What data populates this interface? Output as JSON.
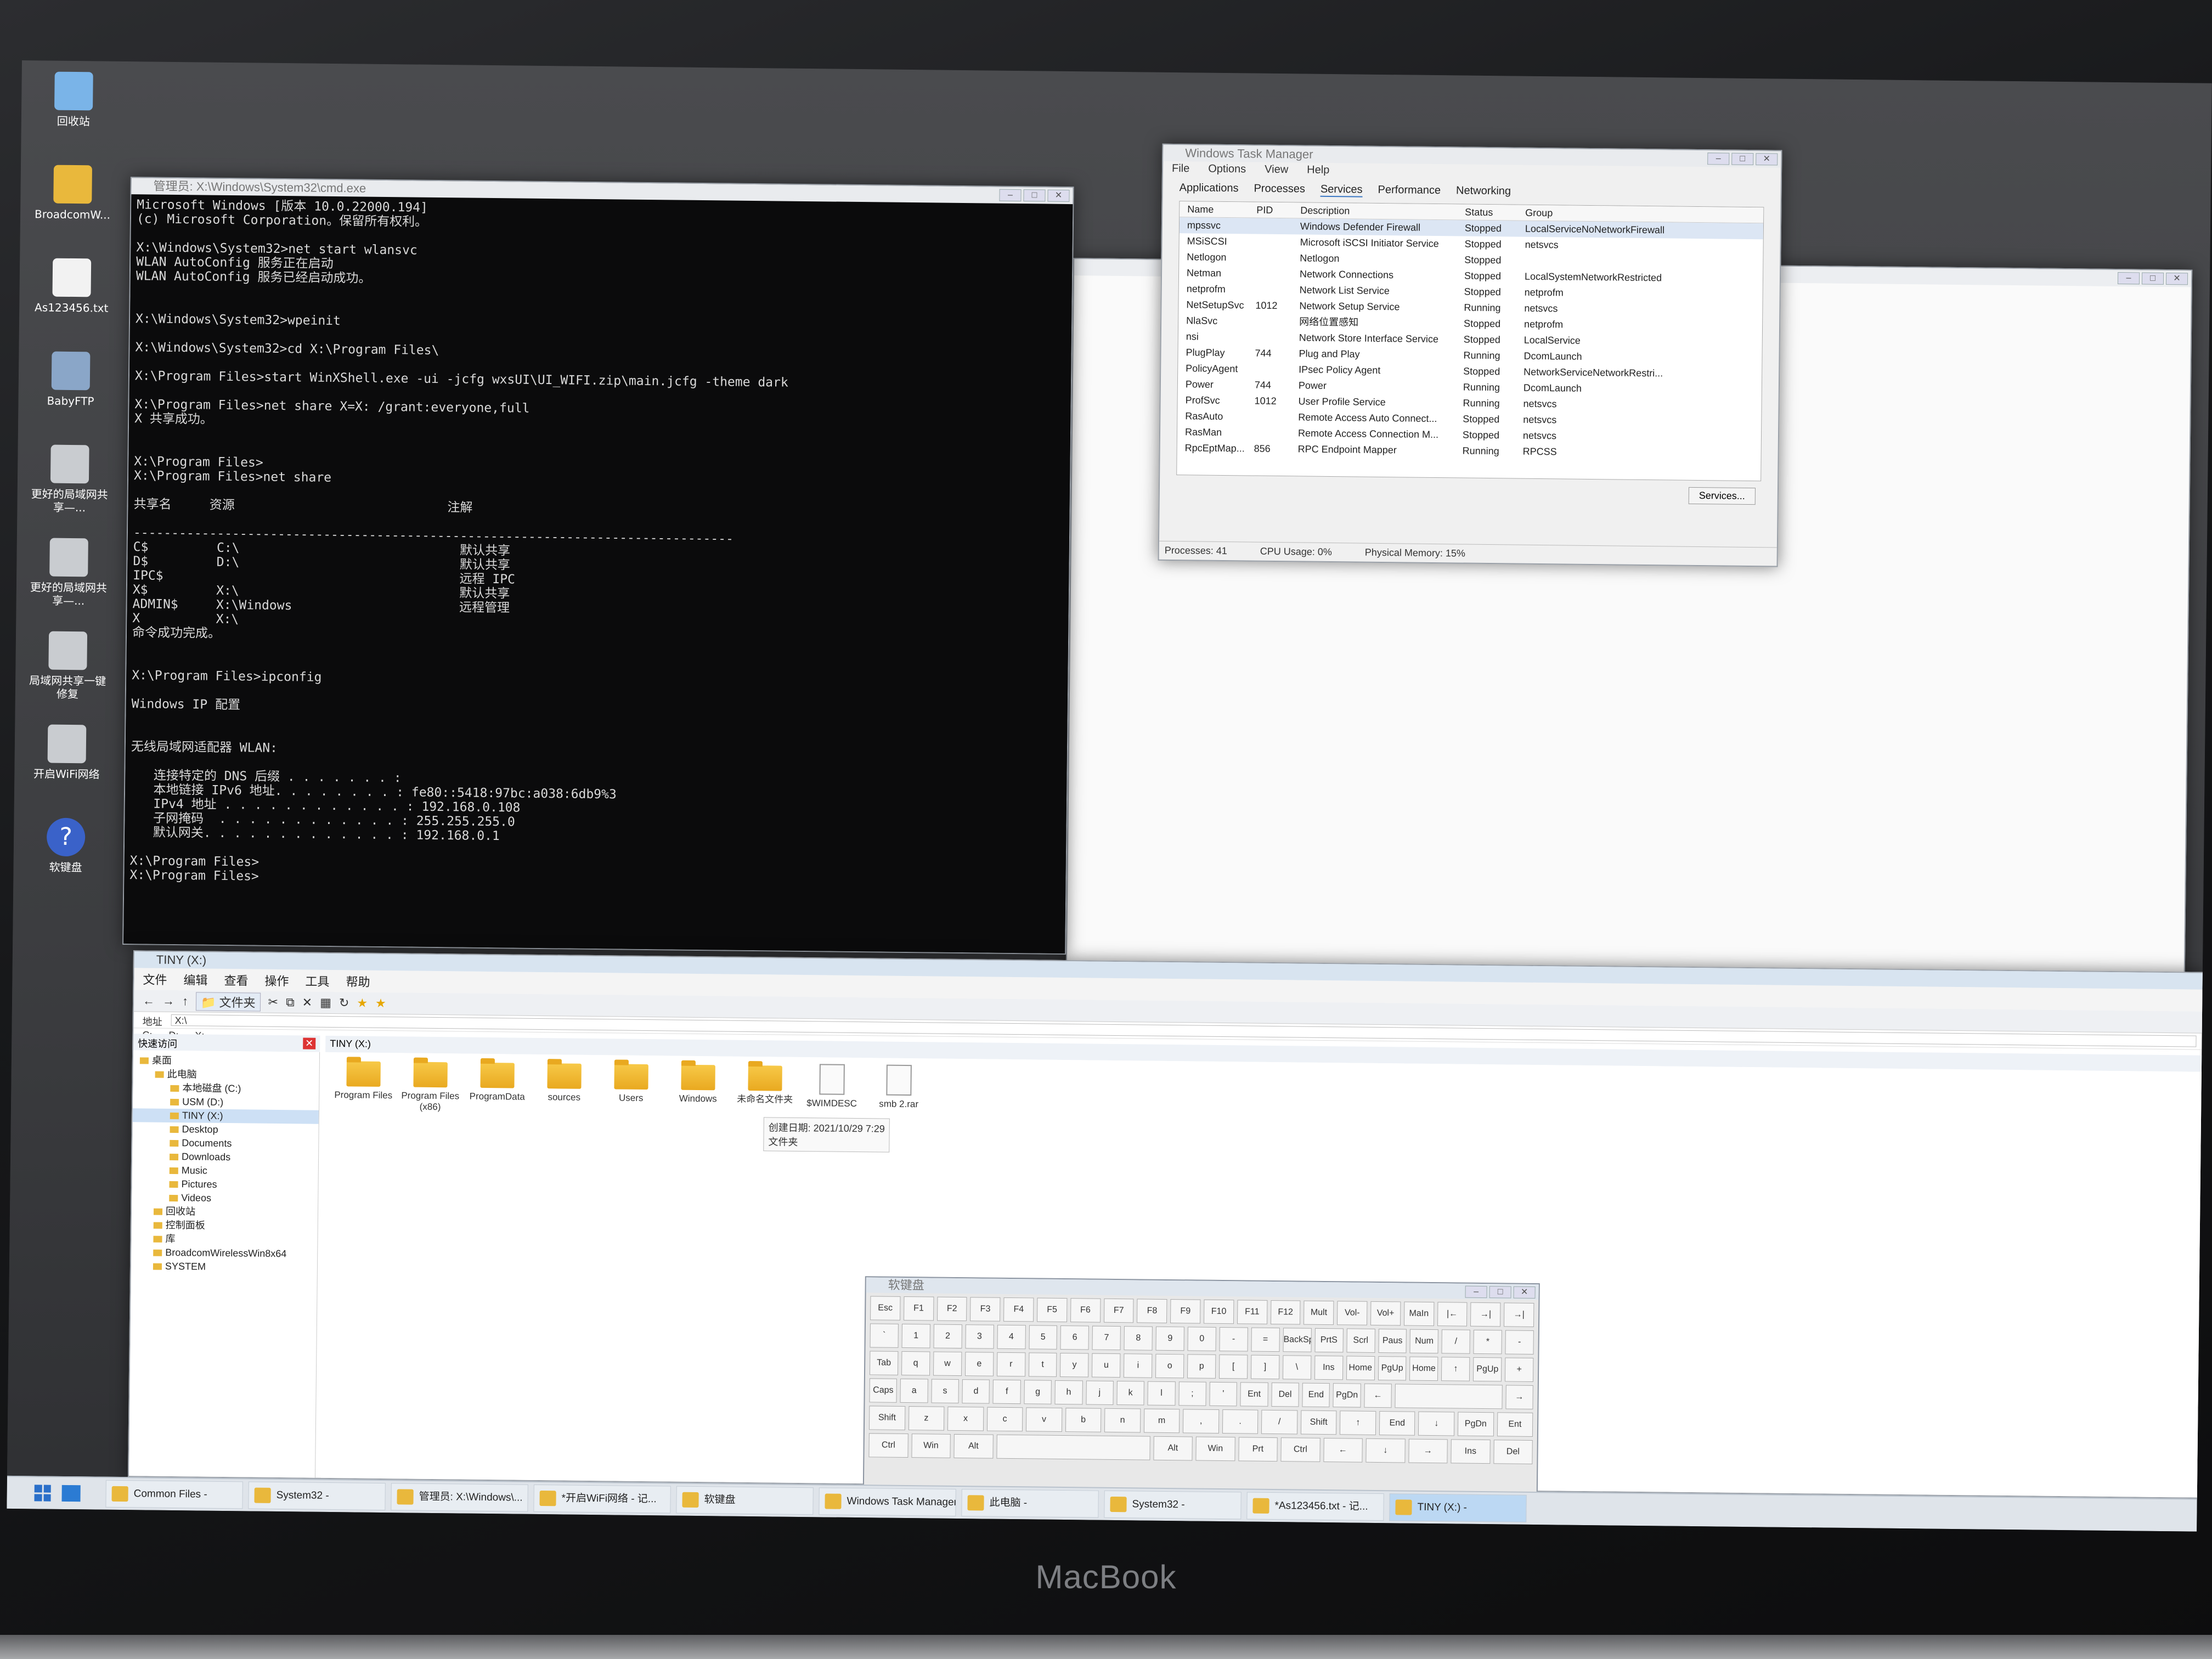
{
  "desktop": {
    "icons": [
      {
        "label": "回收站",
        "icon": "recycle-bin-icon"
      },
      {
        "label": "BroadcomW...",
        "icon": "folder-icon"
      },
      {
        "label": "As123456.txt",
        "icon": "text-file-icon"
      },
      {
        "label": "BabyFTP",
        "icon": "ftp-server-icon"
      },
      {
        "label": "更好的局域网共享—...",
        "icon": "gear-icon"
      },
      {
        "label": "更好的局域网共享—...",
        "icon": "gear-icon"
      },
      {
        "label": "局域网共享一键修复",
        "icon": "gear-icon"
      },
      {
        "label": "开启WiFi网络",
        "icon": "gear-icon"
      },
      {
        "label": "软键盘",
        "icon": "help-icon"
      }
    ]
  },
  "cmd": {
    "title": "管理员: X:\\Windows\\System32\\cmd.exe",
    "lines": [
      "Microsoft Windows [版本 10.0.22000.194]",
      "(c) Microsoft Corporation。保留所有权利。",
      "",
      "X:\\Windows\\System32>net start wlansvc",
      "WLAN AutoConfig 服务正在启动",
      "WLAN AutoConfig 服务已经启动成功。",
      "",
      "",
      "X:\\Windows\\System32>wpeinit",
      "",
      "X:\\Windows\\System32>cd X:\\Program Files\\",
      "",
      "X:\\Program Files>start WinXShell.exe -ui -jcfg wxsUI\\UI_WIFI.zip\\main.jcfg -theme dark",
      "",
      "X:\\Program Files>net share X=X: /grant:everyone,full",
      "X 共享成功。",
      "",
      "",
      "X:\\Program Files>",
      "X:\\Program Files>net share",
      "",
      "共享名     资源                            注解",
      "",
      "-------------------------------------------------------------------------------",
      "C$         C:\\                             默认共享",
      "D$         D:\\                             默认共享",
      "IPC$                                       远程 IPC",
      "X$         X:\\                             默认共享",
      "ADMIN$     X:\\Windows                      远程管理",
      "X          X:\\",
      "命令成功完成。",
      "",
      "",
      "X:\\Program Files>ipconfig",
      "",
      "Windows IP 配置",
      "",
      "",
      "无线局域网适配器 WLAN:",
      "",
      "   连接特定的 DNS 后缀 . . . . . . . :",
      "   本地链接 IPv6 地址. . . . . . . . : fe80::5418:97bc:a038:6db9%3",
      "   IPv4 地址 . . . . . . . . . . . . : 192.168.0.108",
      "   子网掩码  . . . . . . . . . . . . : 255.255.255.0",
      "   默认网关. . . . . . . . . . . . . : 192.168.0.1",
      "",
      "X:\\Program Files>",
      "X:\\Program Files>"
    ]
  },
  "taskmgr": {
    "title": "Windows Task Manager",
    "menu": [
      "File",
      "Options",
      "View",
      "Help"
    ],
    "tabs": [
      "Applications",
      "Processes",
      "Services",
      "Performance",
      "Networking"
    ],
    "columns": [
      "Name",
      "PID",
      "Description",
      "Status",
      "Group"
    ],
    "rows": [
      [
        "mpssvc",
        "",
        "Windows Defender Firewall",
        "Stopped",
        "LocalServiceNoNetworkFirewall"
      ],
      [
        "MSiSCSI",
        "",
        "Microsoft iSCSI Initiator Service",
        "Stopped",
        "netsvcs"
      ],
      [
        "Netlogon",
        "",
        "Netlogon",
        "Stopped",
        ""
      ],
      [
        "Netman",
        "",
        "Network Connections",
        "Stopped",
        "LocalSystemNetworkRestricted"
      ],
      [
        "netprofm",
        "",
        "Network List Service",
        "Stopped",
        "netprofm"
      ],
      [
        "NetSetupSvc",
        "1012",
        "Network Setup Service",
        "Running",
        "netsvcs"
      ],
      [
        "NlaSvc",
        "",
        "网络位置感知",
        "Stopped",
        "netprofm"
      ],
      [
        "nsi",
        "",
        "Network Store Interface Service",
        "Stopped",
        "LocalService"
      ],
      [
        "PlugPlay",
        "744",
        "Plug and Play",
        "Running",
        "DcomLaunch"
      ],
      [
        "PolicyAgent",
        "",
        "IPsec Policy Agent",
        "Stopped",
        "NetworkServiceNetworkRestri..."
      ],
      [
        "Power",
        "744",
        "Power",
        "Running",
        "DcomLaunch"
      ],
      [
        "ProfSvc",
        "1012",
        "User Profile Service",
        "Running",
        "netsvcs"
      ],
      [
        "RasAuto",
        "",
        "Remote Access Auto Connect...",
        "Stopped",
        "netsvcs"
      ],
      [
        "RasMan",
        "",
        "Remote Access Connection M...",
        "Stopped",
        "netsvcs"
      ],
      [
        "RpcEptMap...",
        "856",
        "RPC Endpoint Mapper",
        "Running",
        "RPCSS"
      ]
    ],
    "services_button": "Services...",
    "status": {
      "processes": "Processes: 41",
      "cpu": "CPU Usage: 0%",
      "memory": "Physical Memory: 15%"
    }
  },
  "explorer": {
    "title": "TINY (X:)",
    "menu": [
      "文件",
      "编辑",
      "查看",
      "操作",
      "工具",
      "帮助"
    ],
    "toolbar_folder": "文件夹",
    "address_label": "地址",
    "address_value": "X:\\",
    "drives": [
      "C:",
      "D:",
      "X:"
    ],
    "quick_access": "快速访问",
    "pane_title": "TINY (X:)",
    "tree": [
      {
        "label": "桌面",
        "indent": 0
      },
      {
        "label": "此电脑",
        "indent": 1
      },
      {
        "label": "本地磁盘 (C:)",
        "indent": 2
      },
      {
        "label": "USM (D:)",
        "indent": 2
      },
      {
        "label": "TINY (X:)",
        "indent": 2
      },
      {
        "label": "Desktop",
        "indent": 2
      },
      {
        "label": "Documents",
        "indent": 2
      },
      {
        "label": "Downloads",
        "indent": 2
      },
      {
        "label": "Music",
        "indent": 2
      },
      {
        "label": "Pictures",
        "indent": 2
      },
      {
        "label": "Videos",
        "indent": 2
      },
      {
        "label": "回收站",
        "indent": 1
      },
      {
        "label": "控制面板",
        "indent": 1
      },
      {
        "label": "库",
        "indent": 1
      },
      {
        "label": "BroadcomWirelessWin8x64",
        "indent": 1
      },
      {
        "label": "SYSTEM",
        "indent": 1
      }
    ],
    "files": [
      {
        "name": "Program Files",
        "kind": "folder"
      },
      {
        "name": "Program Files (x86)",
        "kind": "folder"
      },
      {
        "name": "ProgramData",
        "kind": "folder"
      },
      {
        "name": "sources",
        "kind": "folder"
      },
      {
        "name": "Users",
        "kind": "folder"
      },
      {
        "name": "Windows",
        "kind": "folder"
      },
      {
        "name": "未命名文件夹",
        "kind": "folder"
      },
      {
        "name": "$WIMDESC",
        "kind": "file"
      },
      {
        "name": "smb 2.rar",
        "kind": "file"
      }
    ],
    "tooltip_line1": "创建日期: 2021/10/29 7:29",
    "tooltip_line2": "文件夹"
  },
  "keyboard": {
    "title": "软键盘",
    "rows": [
      [
        "Esc",
        "F1",
        "F2",
        "F3",
        "F4",
        "F5",
        "F6",
        "F7",
        "F8",
        "F9",
        "F10",
        "F11",
        "F12",
        "Mult",
        "Vol-",
        "Vol+",
        "MaIn",
        "|←",
        "→|",
        "→|"
      ],
      [
        "`",
        "1",
        "2",
        "3",
        "4",
        "5",
        "6",
        "7",
        "8",
        "9",
        "0",
        "-",
        "=",
        "BackSpa",
        "PrtS",
        "Scrl",
        "Paus",
        "Num",
        "/",
        "*",
        "-"
      ],
      [
        "Tab",
        "q",
        "w",
        "e",
        "r",
        "t",
        "y",
        "u",
        "i",
        "o",
        "p",
        "[",
        "]",
        "\\",
        "Ins",
        "Home",
        "PgUp",
        "Home",
        "↑",
        "PgUp",
        "+"
      ],
      [
        "Caps",
        "a",
        "s",
        "d",
        "f",
        "g",
        "h",
        "j",
        "k",
        "l",
        ";",
        "'",
        "Ent",
        "Del",
        "End",
        "PgDn",
        "←",
        "",
        "→"
      ],
      [
        "Shift",
        "z",
        "x",
        "c",
        "v",
        "b",
        "n",
        "m",
        ",",
        ".",
        "/",
        "Shift",
        "↑",
        "End",
        "↓",
        "PgDn",
        "Ent"
      ],
      [
        "Ctrl",
        "Win",
        "Alt",
        "",
        "Alt",
        "Win",
        "Prt",
        "Ctrl",
        "←",
        "↓",
        "→",
        "Ins",
        "Del"
      ]
    ]
  },
  "taskbar": {
    "items": [
      "Common Files -",
      "System32 -",
      "管理员: X:\\Windows\\...",
      "*开启WiFi网络 - 记...",
      "软键盘",
      "Windows Task Manager",
      "此电脑 -",
      "System32 -",
      "*As123456.txt - 记...",
      "TINY (X:) -"
    ]
  },
  "laptop_brand": "MacBook"
}
